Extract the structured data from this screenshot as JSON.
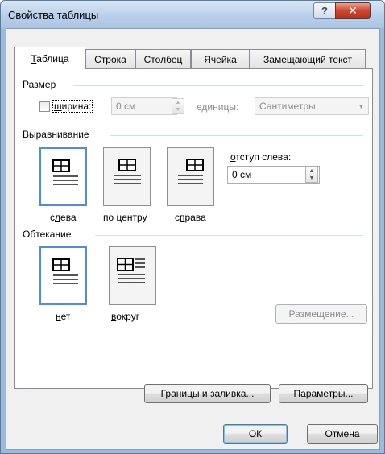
{
  "window": {
    "title": "Свойства таблицы",
    "help_glyph": "?",
    "close_glyph": "✕"
  },
  "tabs": [
    {
      "key": "Т",
      "rest": "аблица",
      "active": true
    },
    {
      "key": "С",
      "rest": "трока",
      "active": false
    },
    {
      "pre": "Стол",
      "key": "б",
      "rest": "ец",
      "active": false
    },
    {
      "key": "Я",
      "rest": "чейка",
      "active": false
    },
    {
      "key": "З",
      "rest": "амещающий текст",
      "active": false
    }
  ],
  "size": {
    "header": "Размер",
    "width_checkbox_checked": false,
    "width_key": "ш",
    "width_rest": "ирина:",
    "width_value": "0 см",
    "units_label": "единицы:",
    "units_value": "Сантиметры"
  },
  "alignment": {
    "header": "Выравнивание",
    "left_key": "л",
    "left_pre": "с",
    "left_rest": "ева",
    "center_label": "по центру",
    "right_pre": "с",
    "right_key": "п",
    "right_rest": "рава",
    "selected": "left",
    "indent_key": "о",
    "indent_rest": "тступ слева:",
    "indent_value": "0 см"
  },
  "wrapping": {
    "header": "Обтекание",
    "none_key": "н",
    "none_rest": "ет",
    "around_key": "в",
    "around_rest": "округ",
    "selected": "none",
    "placement_label": "Размещение..."
  },
  "buttons": {
    "borders_key": "Г",
    "borders_rest": "раницы и заливка...",
    "params_key": "П",
    "params_rest": "араметры...",
    "ok_label": "ОК",
    "cancel_label": "Отмена"
  },
  "colors": {
    "title_bar": "#b9d0ea",
    "close_button": "#cc4a32",
    "selection_border": "#4e8fd9",
    "dialog_face": "#f0f0f0"
  }
}
